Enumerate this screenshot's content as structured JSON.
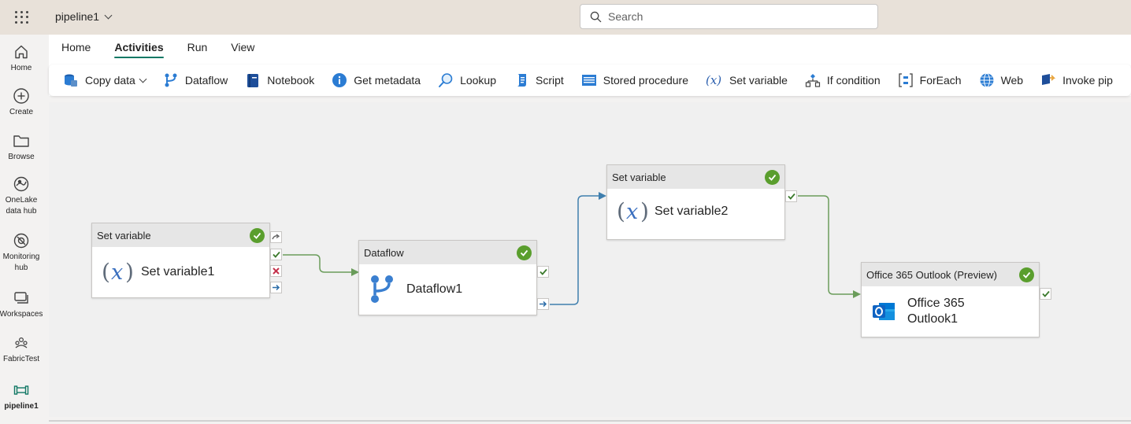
{
  "topbar": {
    "pipeline_name": "pipeline1",
    "search_placeholder": "Search"
  },
  "leftnav": [
    {
      "label": "Home",
      "icon": "home-icon"
    },
    {
      "label": "Create",
      "icon": "create-icon"
    },
    {
      "label": "Browse",
      "icon": "folder-icon"
    },
    {
      "label": "OneLake data hub",
      "icon": "onelake-icon"
    },
    {
      "label": "Monitoring hub",
      "icon": "monitoring-icon"
    },
    {
      "label": "Workspaces",
      "icon": "workspaces-icon"
    },
    {
      "label": "FabricTest",
      "icon": "workspace-people-icon"
    },
    {
      "label": "pipeline1",
      "icon": "pipeline-icon"
    }
  ],
  "ribbon": {
    "tabs": [
      "Home",
      "Activities",
      "Run",
      "View"
    ],
    "active_tab": "Activities",
    "tools": [
      {
        "label": "Copy data",
        "icon": "copy-data-icon",
        "dropdown": true
      },
      {
        "label": "Dataflow",
        "icon": "dataflow-icon"
      },
      {
        "label": "Notebook",
        "icon": "notebook-icon"
      },
      {
        "label": "Get metadata",
        "icon": "info-icon"
      },
      {
        "label": "Lookup",
        "icon": "lookup-icon"
      },
      {
        "label": "Script",
        "icon": "script-icon"
      },
      {
        "label": "Stored procedure",
        "icon": "stored-procedure-icon"
      },
      {
        "label": "Set variable",
        "icon": "variable-icon"
      },
      {
        "label": "If condition",
        "icon": "if-condition-icon"
      },
      {
        "label": "ForEach",
        "icon": "foreach-icon"
      },
      {
        "label": "Web",
        "icon": "web-icon"
      },
      {
        "label": "Invoke pip",
        "icon": "invoke-pipeline-icon"
      }
    ]
  },
  "canvas": {
    "nodes": [
      {
        "type": "Set variable",
        "name": "Set variable1",
        "status": "succeeded"
      },
      {
        "type": "Dataflow",
        "name": "Dataflow1",
        "status": "succeeded"
      },
      {
        "type": "Set variable",
        "name": "Set variable2",
        "status": "succeeded"
      },
      {
        "type": "Office 365 Outlook (Preview)",
        "name_line1": "Office 365",
        "name_line2": "Outlook1",
        "status": "succeeded"
      }
    ]
  },
  "colors": {
    "accent": "#117865",
    "success": "#5a9e2d",
    "wire_success": "#6a9c5a",
    "wire_completion": "#3f7fae",
    "fail": "#c4314b"
  }
}
